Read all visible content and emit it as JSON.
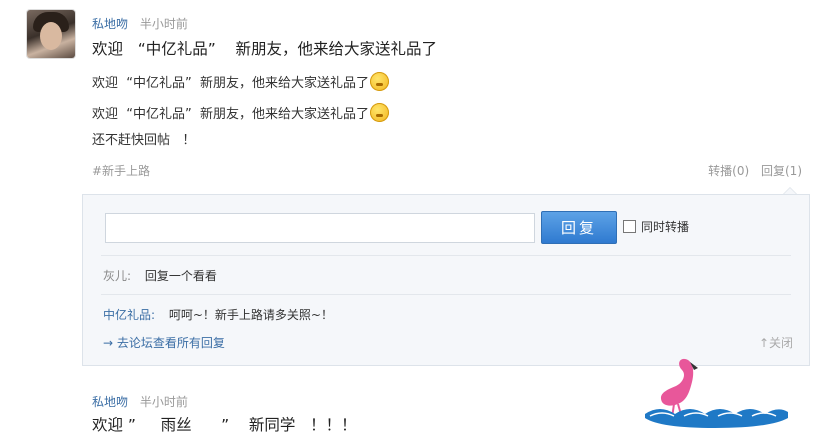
{
  "post1": {
    "user": "私地吻",
    "time": "半小时前",
    "headline": "欢迎   “中亿礼品”    新朋友，他来给大家送礼品了",
    "lines": [
      "欢迎  “中亿礼品”  新朋友，他来给大家送礼品了",
      "欢迎  “中亿礼品”  新朋友，他来给大家送礼品了",
      "还不赶快回帖   ！"
    ],
    "tag": "#新手上路",
    "repost_label": "转播(0)",
    "reply_label": "回复(1)"
  },
  "reply_panel": {
    "input_value": "",
    "button_label": "回复",
    "sync_label": "同时转播",
    "replies": [
      {
        "user": "灰儿:",
        "text": "回复一个看看"
      },
      {
        "user": "中亿礼品:",
        "text": "呵呵~！新手上路请多关照~！"
      }
    ],
    "more_link": "→ 去论坛查看所有回复",
    "close_label": "↑关闭"
  },
  "post2": {
    "user": "私地吻",
    "time": "半小时前",
    "headline": "欢迎 ”     雨丝      ”    新同学   ！！！"
  },
  "colors": {
    "accent": "#3b6ea5",
    "button": "#2f7ad0",
    "panel_bg": "#f5f7fa"
  },
  "icons": {
    "emoji": "smiley-emoji-icon",
    "flamingo": "flamingo-logo-icon"
  }
}
